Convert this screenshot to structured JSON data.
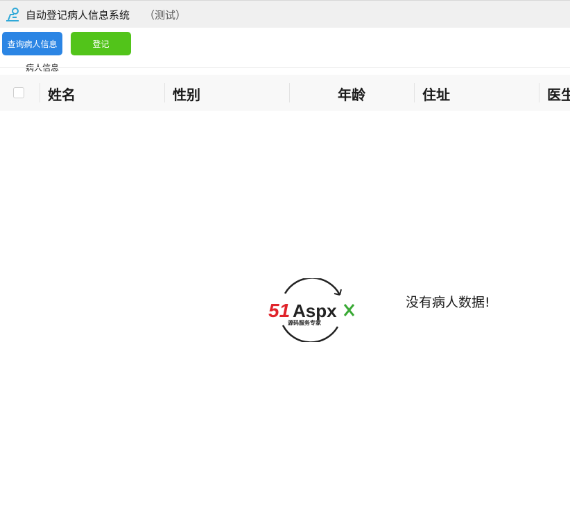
{
  "window": {
    "title": "自动登记病人信息系统",
    "subtitle": "（测试）"
  },
  "toolbar": {
    "query_label": "查询病人信息",
    "register_label": "登记"
  },
  "tabs": [
    {
      "label": "病人信息"
    }
  ],
  "table": {
    "columns": [
      "姓名",
      "性别",
      "年龄",
      "住址",
      "医生"
    ]
  },
  "empty_state": {
    "message": "没有病人数据!",
    "logo_text_a": "51",
    "logo_text_b": "Aspx",
    "logo_tagline": "源码服务专家"
  },
  "colors": {
    "query_button": "#2b85e4",
    "register_button": "#52c41a",
    "logo_red": "#e0232a",
    "logo_green": "#3aa935"
  }
}
